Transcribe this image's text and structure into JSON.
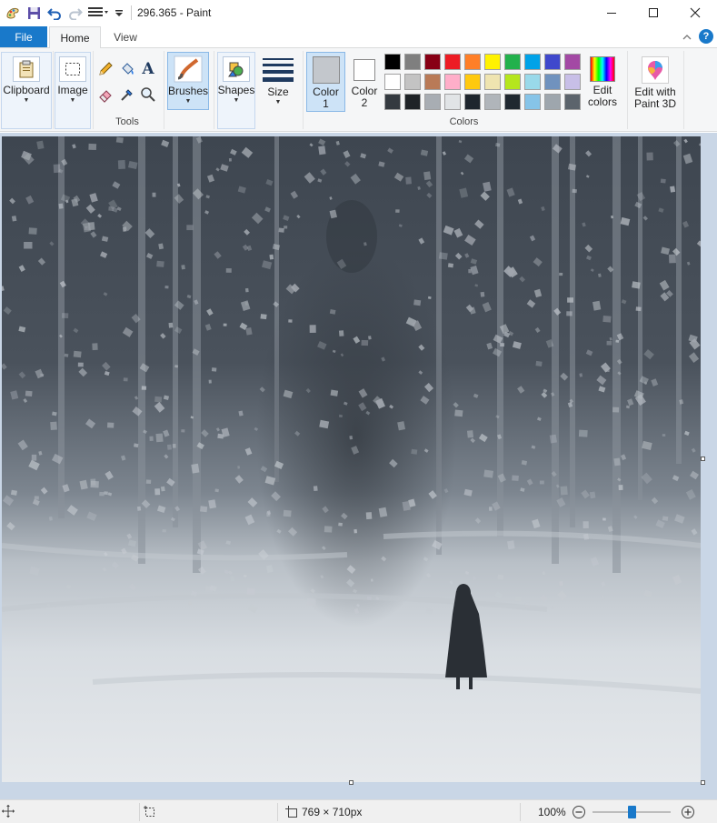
{
  "window": {
    "title": "296.365 - Paint",
    "controls": {
      "minimize": "—",
      "maximize": "☐",
      "close": "✕"
    }
  },
  "tabs": {
    "file": "File",
    "home": "Home",
    "view": "View",
    "help": "?"
  },
  "ribbon": {
    "clipboard": {
      "label": "Clipboard"
    },
    "image": {
      "label": "Image"
    },
    "tools": {
      "group_label": "Tools",
      "text_tool": "A"
    },
    "brushes": {
      "label": "Brushes"
    },
    "shapes": {
      "label": "Shapes"
    },
    "size": {
      "label": "Size"
    },
    "color1": {
      "label_line1": "Color",
      "label_line2": "1",
      "color": "#c3c7cc"
    },
    "color2": {
      "label_line1": "Color",
      "label_line2": "2",
      "color": "#ffffff"
    },
    "colors_group_label": "Colors",
    "edit_colors": {
      "line1": "Edit",
      "line2": "colors"
    },
    "edit_paint3d": {
      "line1": "Edit with",
      "line2": "Paint 3D"
    },
    "palette": [
      [
        "#000000",
        "#7f7f7f",
        "#880015",
        "#ed1c24",
        "#ff7f27",
        "#fff200",
        "#22b14c",
        "#00a2e8",
        "#3f48cc",
        "#a349a4"
      ],
      [
        "#ffffff",
        "#c3c3c3",
        "#b97a57",
        "#ffaec9",
        "#ffc90e",
        "#efe4b0",
        "#b5e61d",
        "#99d9ea",
        "#7092be",
        "#c8bfe7"
      ],
      [
        "#343a40",
        "#1f2327",
        "#a8adb3",
        "#e1e4e6",
        "#1e252d",
        "#b0b5ba",
        "#202830",
        "#86c4e8",
        "#9ea6ad",
        "#5c646c"
      ]
    ]
  },
  "status": {
    "canvas_size": "769 × 710px",
    "zoom": "100%",
    "zoom_fraction": 0.5
  }
}
